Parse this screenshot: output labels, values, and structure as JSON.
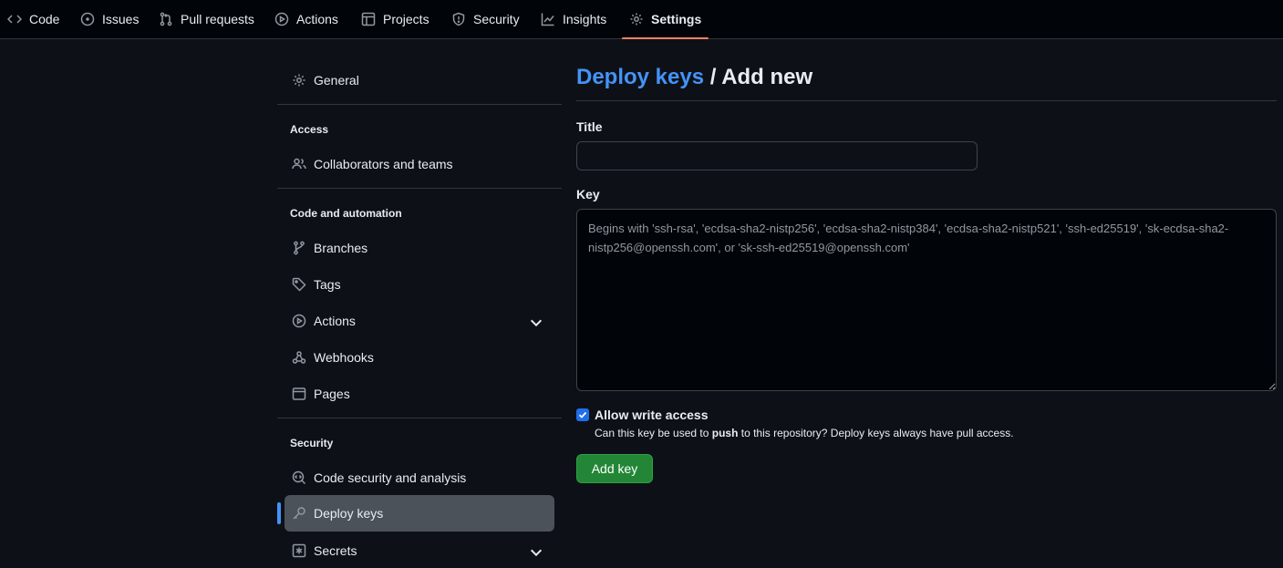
{
  "repo_nav": {
    "tabs": [
      {
        "label": "Code",
        "icon": "code-icon"
      },
      {
        "label": "Issues",
        "icon": "issue-opened-icon"
      },
      {
        "label": "Pull requests",
        "icon": "git-pull-request-icon"
      },
      {
        "label": "Actions",
        "icon": "play-icon"
      },
      {
        "label": "Projects",
        "icon": "table-icon"
      },
      {
        "label": "Security",
        "icon": "shield-icon"
      },
      {
        "label": "Insights",
        "icon": "graph-icon"
      },
      {
        "label": "Settings",
        "icon": "gear-icon",
        "selected": true
      }
    ],
    "accent_color": "#f78166"
  },
  "sidebar": {
    "general": "General",
    "sections": {
      "access": "Access",
      "code_automation": "Code and automation",
      "security": "Security"
    },
    "items": {
      "collaborators": "Collaborators and teams",
      "branches": "Branches",
      "tags": "Tags",
      "actions": "Actions",
      "webhooks": "Webhooks",
      "pages": "Pages",
      "code_security": "Code security and analysis",
      "deploy_keys": "Deploy keys",
      "secrets": "Secrets"
    },
    "active_item": "deploy_keys",
    "active_indicator_color": "#4493f8"
  },
  "main": {
    "heading_link": "Deploy keys",
    "heading_rest": " / Add new",
    "title_label": "Title",
    "title_value": "",
    "key_label": "Key",
    "key_placeholder": "Begins with 'ssh-rsa', 'ecdsa-sha2-nistp256', 'ecdsa-sha2-nistp384', 'ecdsa-sha2-nistp521', 'ssh-ed25519', 'sk-ecdsa-sha2-nistp256@openssh.com', or 'sk-ssh-ed25519@openssh.com'",
    "allow_write_label": "Allow write access",
    "allow_write_checked": true,
    "allow_write_note_pre": "Can this key be used to ",
    "allow_write_note_bold": "push",
    "allow_write_note_post": " to this repository? Deploy keys always have pull access.",
    "submit_label": "Add key",
    "submit_color": "#238636"
  }
}
